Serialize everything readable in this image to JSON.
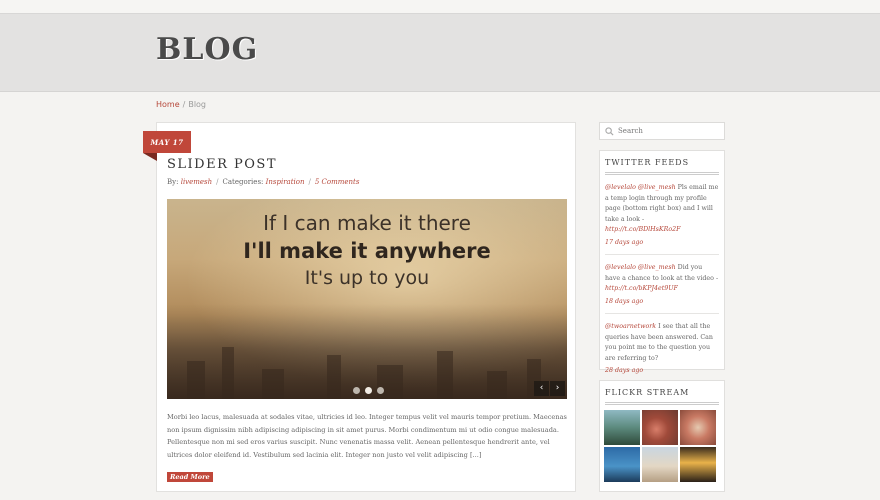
{
  "header": {
    "title": "BLOG"
  },
  "breadcrumb": {
    "home": "Home",
    "separator": "/",
    "current": "Blog"
  },
  "post": {
    "date": "MAY 17",
    "title": "SLIDER POST",
    "meta": {
      "by_label": "By:",
      "author": "livemesh",
      "categories_label": "Categories:",
      "category": "Inspiration",
      "comments": "5 Comments",
      "separator": "/"
    },
    "slider": {
      "line1": "If I can make it there",
      "line2": "I'll make it anywhere",
      "line3": "It's up to you",
      "slide_count": 3,
      "active_slide": 2,
      "prev_icon": "‹",
      "next_icon": "›"
    },
    "excerpt": "Morbi leo lacus, malesuada at sodales vitae, ultricies id leo. Integer tempus velit vel mauris tempor pretium. Maecenas non ipsum dignissim nibh adipiscing adipiscing in sit amet purus. Morbi condimentum mi ut odio congue malesuada. Pellentesque non mi sed eros varius suscipit. Nunc venenatis massa velit. Aenean pellentesque hendrerit ante, vel ultrices dolor eleifend id. Vestibulum sed lacinia elit. Integer non justo vel velit adipiscing",
    "excerpt_more": "[...]",
    "read_more": "Read More"
  },
  "sidebar": {
    "search": {
      "placeholder": "Search"
    },
    "twitter": {
      "title": "TWITTER FEEDS",
      "tweets": [
        {
          "mention": "@levelalo @live_mesh",
          "text": " Pls email me a temp login through my profile page (bottom right box) and I will take a look - ",
          "link": "http://t.co/BDlHsKRo2F",
          "time": "17 days ago"
        },
        {
          "mention": "@levelalo @live_mesh",
          "text": " Did you have a chance to look at the video - ",
          "link": "http://t.co/bKPJ4et9UF",
          "time": "18 days ago"
        },
        {
          "mention": "@twoarnetwork",
          "text": " I see that all the queries have been answered. Can you point me to the question you are referring to?",
          "link": "",
          "time": "28 days ago"
        }
      ]
    },
    "flickr": {
      "title": "FLICKR STREAM",
      "photo_count": 6
    }
  },
  "colors": {
    "accent": "#c0473a",
    "link": "#b6483b",
    "header_band": "#e3e2e1",
    "page_bg": "#f4f3f1"
  },
  "icons": {
    "search": "search-icon"
  }
}
